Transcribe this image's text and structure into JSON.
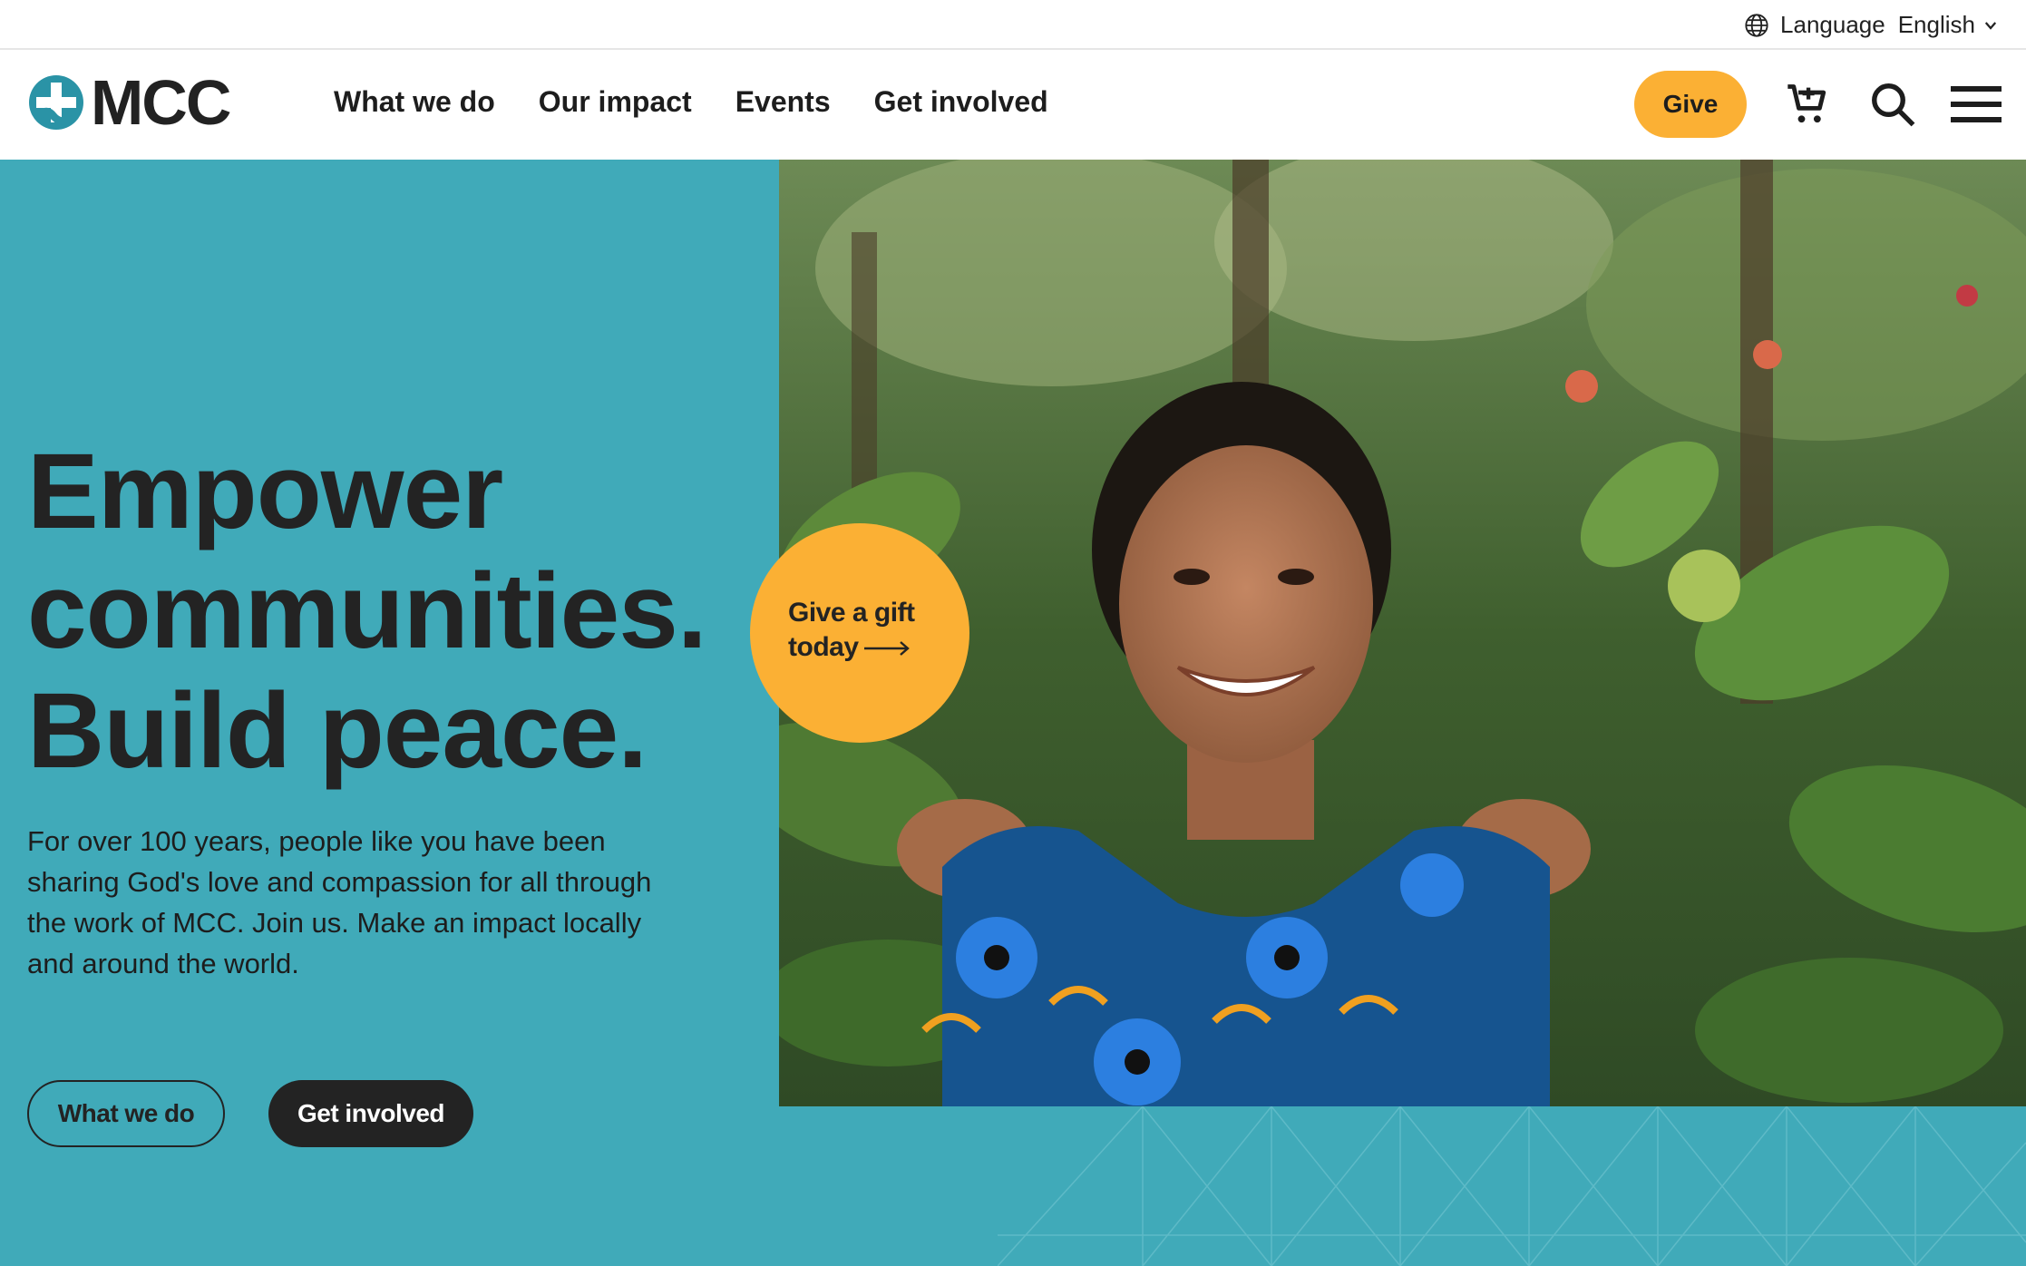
{
  "utility": {
    "language_label": "Language",
    "language_value": "English"
  },
  "nav": {
    "logo_text": "MCC",
    "links": [
      "What we do",
      "Our impact",
      "Events",
      "Get involved"
    ],
    "give_label": "Give",
    "icons": [
      "cart-icon",
      "search-icon",
      "menu-icon"
    ]
  },
  "hero": {
    "headline": [
      "Empower",
      "communities.",
      "Build peace."
    ],
    "intro": "For over 100 years, people like you have been sharing God's love and compassion for all through the work of MCC. Join us. Make an impact locally and around the world.",
    "cta_gift_line1": "Give a gift",
    "cta_gift_line2": "today",
    "btn_what_we_do": "What we do",
    "btn_get_involved": "Get involved"
  },
  "colors": {
    "teal": "#40aab9",
    "accent_yellow": "#fbb034",
    "dark": "#232323"
  }
}
